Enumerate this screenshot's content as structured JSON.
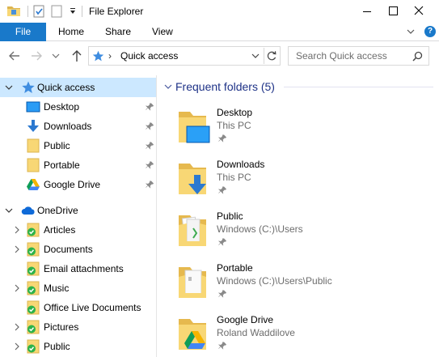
{
  "window": {
    "title": "File Explorer",
    "icons": [
      "folder-icon",
      "properties-icon",
      "new-folder-icon",
      "customize-dropdown-icon"
    ]
  },
  "ribbon": {
    "file_label": "File",
    "tabs": [
      {
        "label": "Home"
      },
      {
        "label": "Share"
      },
      {
        "label": "View"
      }
    ],
    "help_label": "?"
  },
  "navigation": {
    "address_separator": "›",
    "address_text": "Quick access",
    "search_placeholder": "Search Quick access"
  },
  "sidebar": {
    "quick_access": {
      "label": "Quick access",
      "items": [
        {
          "label": "Desktop",
          "icon": "desktop-icon"
        },
        {
          "label": "Downloads",
          "icon": "downloads-icon"
        },
        {
          "label": "Public",
          "icon": "folder-icon"
        },
        {
          "label": "Portable",
          "icon": "folder-icon"
        },
        {
          "label": "Google Drive",
          "icon": "google-drive-icon"
        }
      ]
    },
    "onedrive": {
      "label": "OneDrive",
      "items": [
        {
          "label": "Articles"
        },
        {
          "label": "Documents"
        },
        {
          "label": "Email attachments"
        },
        {
          "label": "Music"
        },
        {
          "label": "Office Live Documents"
        },
        {
          "label": "Pictures"
        },
        {
          "label": "Public"
        }
      ]
    }
  },
  "content": {
    "group_title": "Frequent folders (5)",
    "folders": [
      {
        "name": "Desktop",
        "location": "This PC",
        "icon": "desktop-folder-icon"
      },
      {
        "name": "Downloads",
        "location": "This PC",
        "icon": "downloads-folder-icon"
      },
      {
        "name": "Public",
        "location": "Windows (C:)\\Users",
        "icon": "public-folder-icon"
      },
      {
        "name": "Portable",
        "location": "Windows (C:)\\Users\\Public",
        "icon": "portable-folder-icon"
      },
      {
        "name": "Google Drive",
        "location": "Roland Waddilove",
        "icon": "google-drive-folder-icon"
      }
    ]
  },
  "colors": {
    "accent": "#1979ca",
    "selection": "#cce8ff",
    "group_title": "#1e3287",
    "folder": "#f8d775",
    "onedrive": "#0f6ad8",
    "sync_ok": "#2db34a"
  }
}
